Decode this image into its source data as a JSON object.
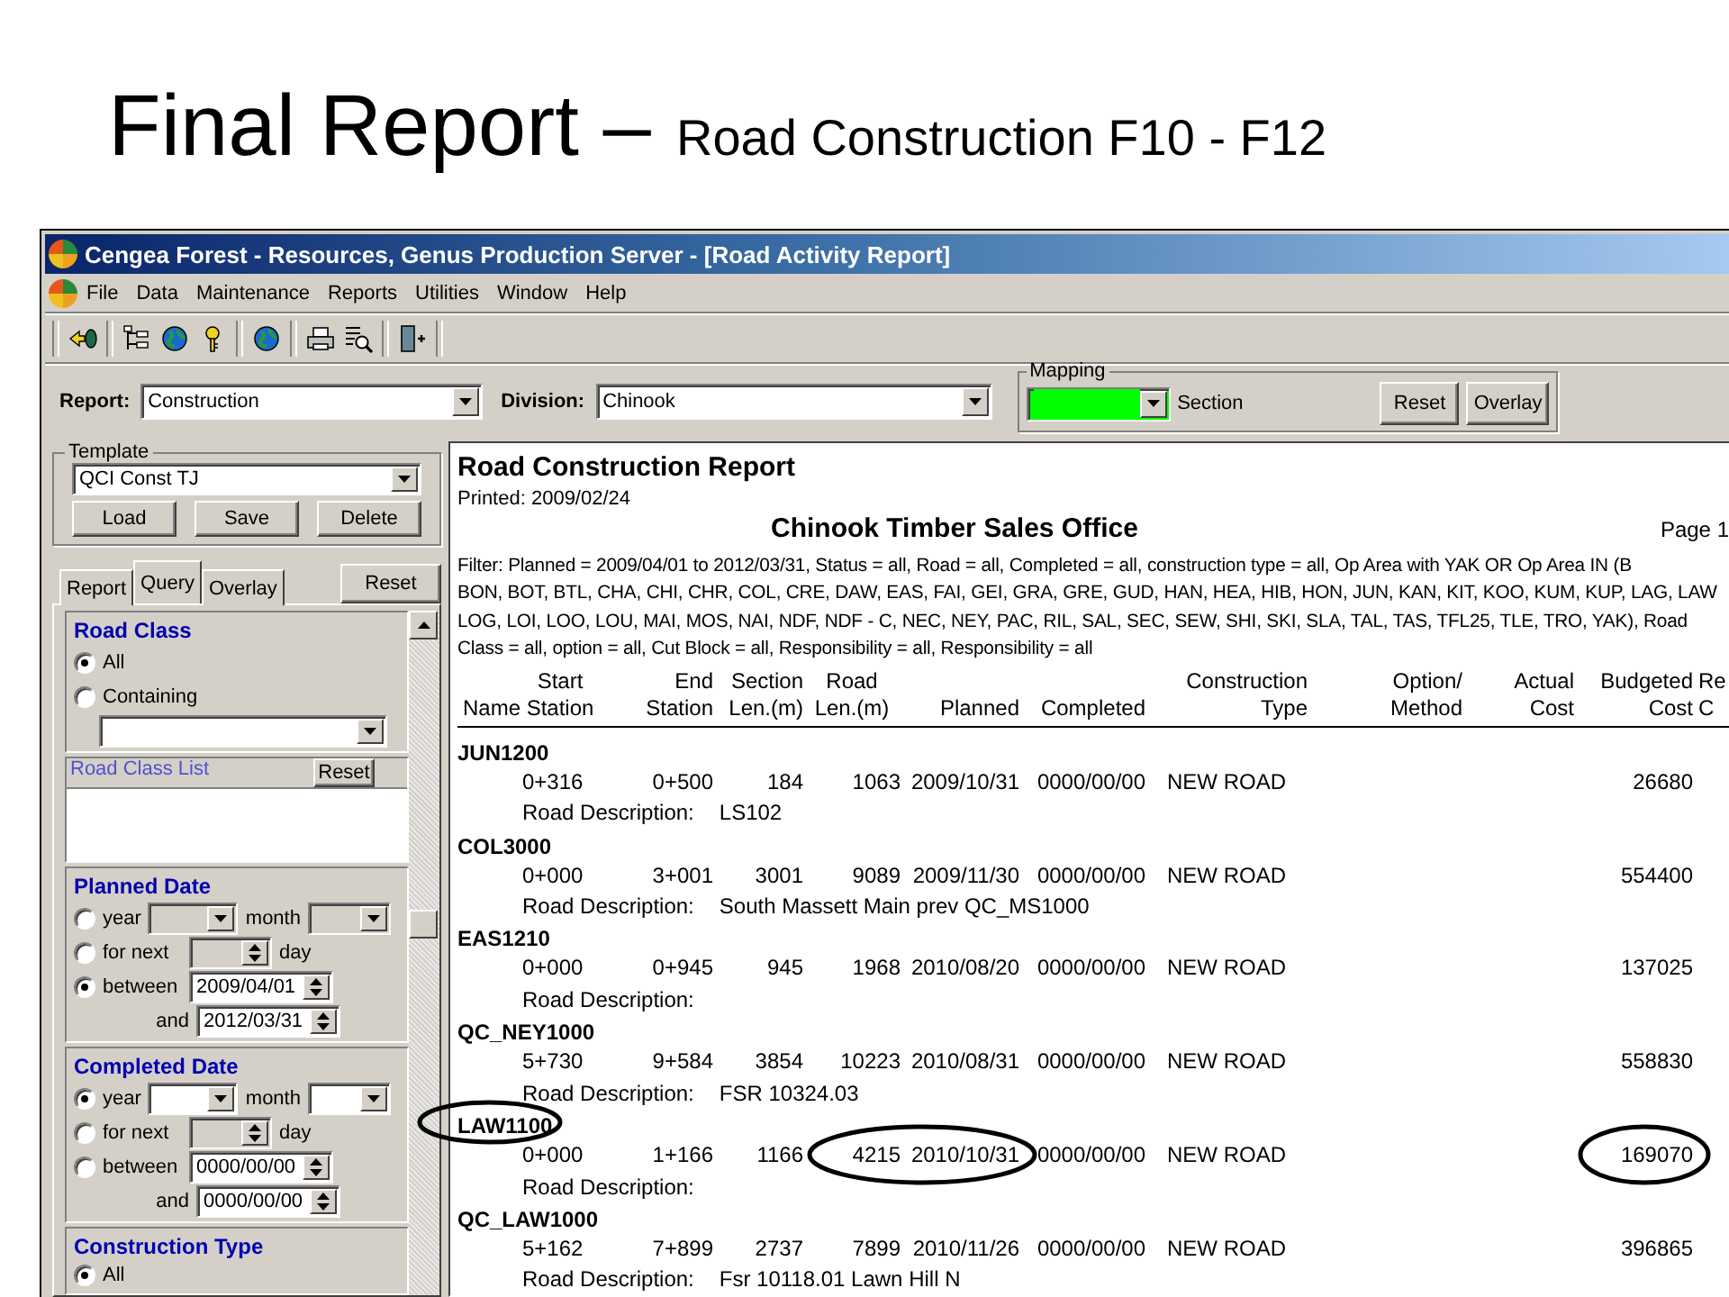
{
  "slide": {
    "title": "Final Report –",
    "subtitle": "Road Construction F10 - F12"
  },
  "window": {
    "title": "Cengea Forest - Resources, Genus Production Server - [Road Activity Report]"
  },
  "menu": [
    "File",
    "Data",
    "Maintenance",
    "Reports",
    "Utilities",
    "Window",
    "Help"
  ],
  "params": {
    "report_label": "Report:",
    "report_value": "Construction",
    "division_label": "Division:",
    "division_value": "Chinook",
    "mapping": {
      "legend": "Mapping",
      "color": "#00ff00",
      "label": "Section"
    },
    "buttons": [
      "Reset",
      "Overlay"
    ]
  },
  "template": {
    "legend": "Template",
    "value": "QCI Const TJ",
    "buttons": [
      "Load",
      "Save",
      "Delete"
    ]
  },
  "tabs": [
    {
      "label": "Report",
      "selected": false
    },
    {
      "label": "Query",
      "selected": true
    },
    {
      "label": "Overlay",
      "selected": false
    }
  ],
  "tabs_reset": "Reset",
  "road_class": {
    "title": "Road Class",
    "options": [
      {
        "label": "All",
        "selected": true
      },
      {
        "label": "Containing",
        "selected": false
      }
    ],
    "list_header": "Road Class List",
    "list_reset": "Reset"
  },
  "date_filters": [
    {
      "title": "Planned Date",
      "options": [
        {
          "kind": "year",
          "label": "year",
          "month_label": "month",
          "selected": false
        },
        {
          "kind": "for_next",
          "label": "for next",
          "unit": "day",
          "selected": false
        },
        {
          "kind": "between",
          "label": "between",
          "from": "2009/04/01",
          "and_label": "and",
          "to": "2012/03/31",
          "selected": true
        }
      ]
    },
    {
      "title": "Completed Date",
      "options": [
        {
          "kind": "year",
          "label": "year",
          "month_label": "month",
          "selected": true
        },
        {
          "kind": "for_next",
          "label": "for next",
          "unit": "day",
          "selected": false
        },
        {
          "kind": "between",
          "label": "between",
          "from": "0000/00/00",
          "and_label": "and",
          "to": "0000/00/00",
          "selected": false
        }
      ]
    }
  ],
  "construction_type": {
    "title": "Construction Type",
    "options": [
      {
        "label": "All",
        "selected": true
      }
    ]
  },
  "report": {
    "title": "Road Construction Report",
    "printed": "Printed:  2009/02/24",
    "office": "Chinook Timber Sales Office",
    "page": "Page 1",
    "filter": [
      "Filter:  Planned = 2009/04/01 to 2012/03/31,  Status = all,  Road = all,  Completed = all,  construction type = all,  Op Area with YAK OR Op Area IN (B",
      "BON, BOT, BTL, CHA, CHI, CHR, COL, CRE, DAW, EAS, FAI, GEI, GRA, GRE, GUD, HAN, HEA, HIB, HON, JUN, KAN, KIT, KOO, KUM, KUP, LAG, LAW",
      "LOG, LOI, LOO, LOU, MAI, MOS, NAI, NDF, NDF - C, NEC, NEY, PAC, RIL, SAL, SEC, SEW, SHI, SKI, SLA, TAL, TAS, TFL25, TLE, TRO, YAK),  Road",
      "Class = all,  option = all,  Cut Block = all,  Responsibility = all,  Responsibility = all"
    ],
    "columns": [
      {
        "lines": [
          "Name"
        ]
      },
      {
        "lines": [
          "Start",
          "Station"
        ]
      },
      {
        "lines": [
          "End",
          "Station"
        ]
      },
      {
        "lines": [
          "Section",
          "Len.(m)"
        ]
      },
      {
        "lines": [
          "Road",
          "Len.(m)"
        ]
      },
      {
        "lines": [
          "Planned"
        ]
      },
      {
        "lines": [
          "Completed"
        ]
      },
      {
        "lines": [
          "Construction",
          "Type"
        ]
      },
      {
        "lines": [
          "Option/",
          "Method"
        ]
      },
      {
        "lines": [
          "Actual",
          "Cost"
        ]
      },
      {
        "lines": [
          "Budgeted",
          "Cost"
        ]
      },
      {
        "lines": [
          "Re",
          "C"
        ]
      }
    ],
    "roads": [
      {
        "name": "JUN1200",
        "start": "0+316",
        "end": "0+500",
        "section": "184",
        "road_len": "1063",
        "planned": "2009/10/31",
        "completed": "0000/00/00",
        "type": "NEW ROAD",
        "budgeted": "26680",
        "description_label": "Road Description:",
        "description": "LS102"
      },
      {
        "name": "COL3000",
        "start": "0+000",
        "end": "3+001",
        "section": "3001",
        "road_len": "9089",
        "planned": "2009/11/30",
        "completed": "0000/00/00",
        "type": "NEW ROAD",
        "budgeted": "554400",
        "description_label": "Road Description:",
        "description": "South Massett Main prev QC_MS1000"
      },
      {
        "name": "EAS1210",
        "start": "0+000",
        "end": "0+945",
        "section": "945",
        "road_len": "1968",
        "planned": "2010/08/20",
        "completed": "0000/00/00",
        "type": "NEW ROAD",
        "budgeted": "137025",
        "description_label": "Road Description:"
      },
      {
        "name": "QC_NEY1000",
        "start": "5+730",
        "end": "9+584",
        "section": "3854",
        "road_len": "10223",
        "planned": "2010/08/31",
        "completed": "0000/00/00",
        "type": "NEW ROAD",
        "budgeted": "558830",
        "description_label": "Road Description:",
        "description": "FSR 10324.03"
      },
      {
        "name": "LAW1100",
        "start": "0+000",
        "end": "1+166",
        "section": "1166",
        "road_len": "4215",
        "planned": "2010/10/31",
        "completed": "0000/00/00",
        "type": "NEW ROAD",
        "budgeted": "169070",
        "description_label": "Road Description:",
        "circled": {
          "name": true,
          "road_len": true,
          "planned": true,
          "budgeted": true
        }
      },
      {
        "name": "QC_LAW1000",
        "start": "5+162",
        "end": "7+899",
        "section": "2737",
        "road_len": "7899",
        "planned": "2010/11/26",
        "completed": "0000/00/00",
        "type": "NEW ROAD",
        "budgeted": "396865",
        "description_label": "Road Description:",
        "description": "Fsr 10118.01 Lawn Hill N"
      }
    ]
  }
}
